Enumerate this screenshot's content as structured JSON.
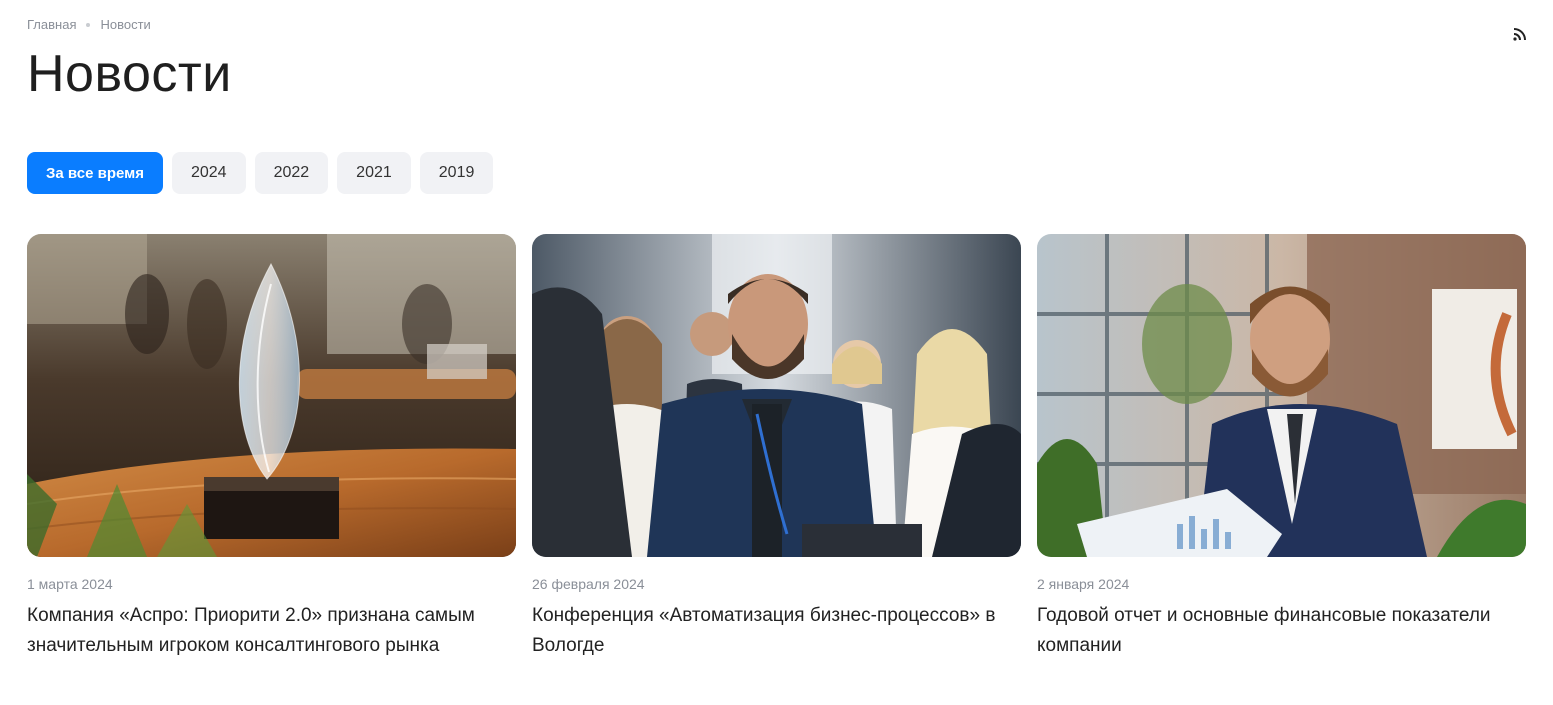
{
  "breadcrumb": {
    "home": "Главная",
    "current": "Новости"
  },
  "page": {
    "title": "Новости"
  },
  "filters": [
    {
      "label": "За все время",
      "active": true
    },
    {
      "label": "2024",
      "active": false
    },
    {
      "label": "2022",
      "active": false
    },
    {
      "label": "2021",
      "active": false
    },
    {
      "label": "2019",
      "active": false
    }
  ],
  "news": [
    {
      "date": "1 марта 2024",
      "title": "Компания «Аспро: Приорити 2.0» признана самым значительным игроком консалтингового рынка",
      "image": "award-trophy-photo"
    },
    {
      "date": "26 февраля 2024",
      "title": "Конференция «Автоматизация бизнес-процессов» в Вологде",
      "image": "conference-audience-photo"
    },
    {
      "date": "2 января 2024",
      "title": "Годовой отчет и основные финансовые показатели компании",
      "image": "businessman-report-photo"
    }
  ],
  "icons": {
    "feed": "rss-icon"
  },
  "colors": {
    "accent": "#0a7dff",
    "chip": "#f1f2f5",
    "muted": "#8a8f98"
  }
}
